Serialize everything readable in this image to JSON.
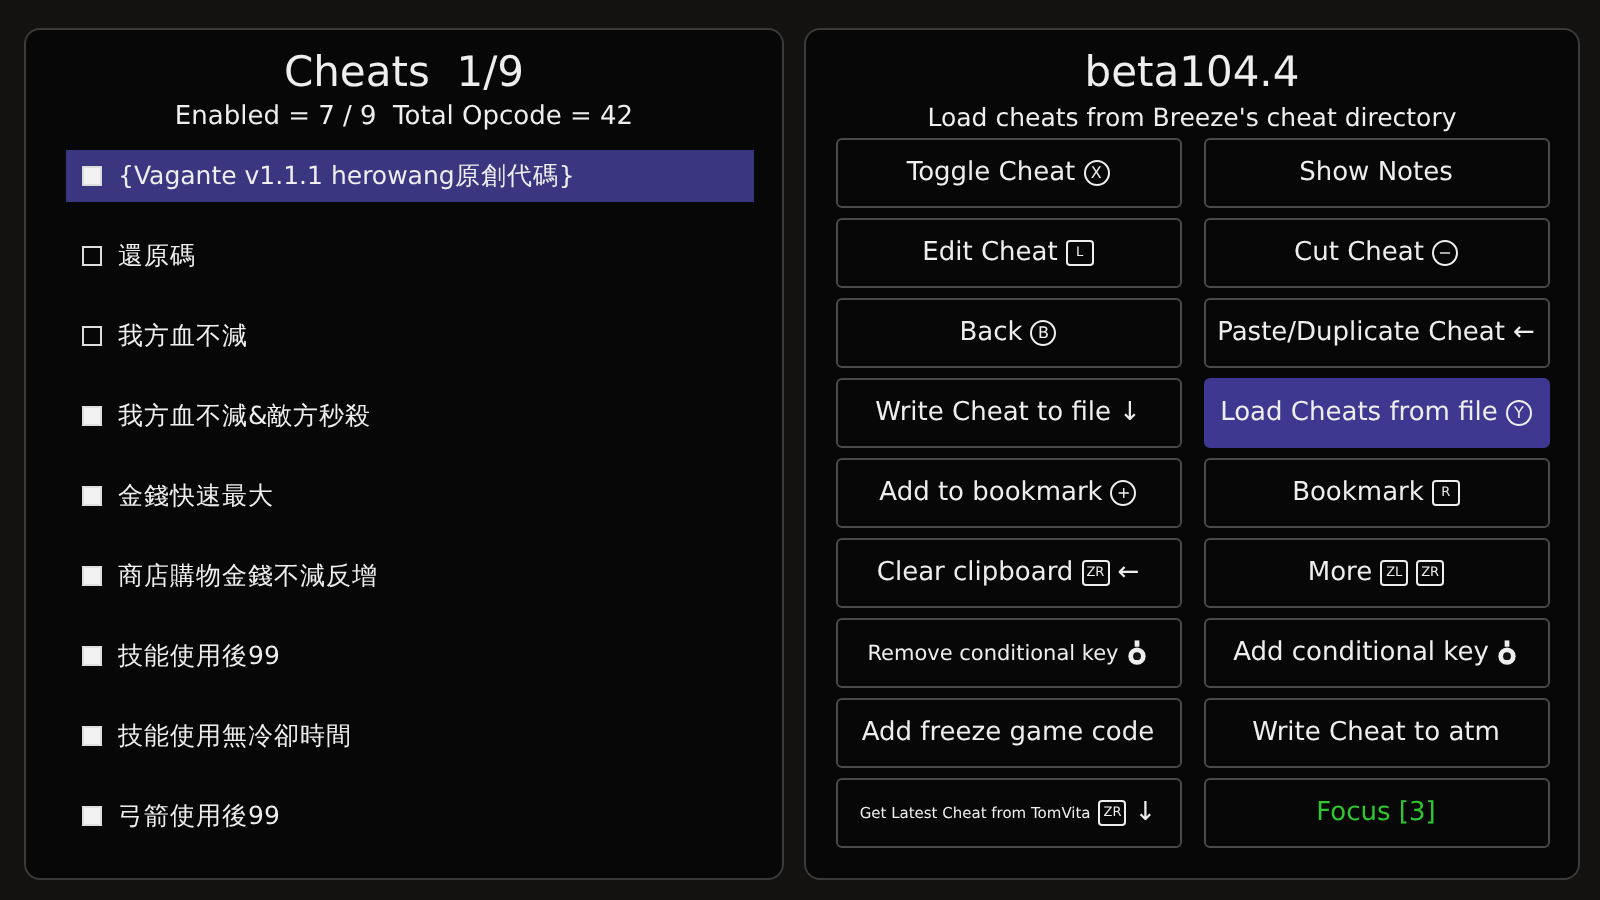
{
  "cheats_panel": {
    "title": "Cheats  1/9",
    "summary": "Enabled = 7 / 9  Total Opcode = 42",
    "items": [
      {
        "label": "{Vagante v1.1.1 herowang原創代碼}",
        "checked": true,
        "selected": true
      },
      {
        "label": "還原碼",
        "checked": false,
        "selected": false
      },
      {
        "label": "我方血不減",
        "checked": false,
        "selected": false
      },
      {
        "label": "我方血不減&敵方秒殺",
        "checked": true,
        "selected": false
      },
      {
        "label": "金錢快速最大",
        "checked": true,
        "selected": false
      },
      {
        "label": "商店購物金錢不減反增",
        "checked": true,
        "selected": false
      },
      {
        "label": "技能使用後99",
        "checked": true,
        "selected": false
      },
      {
        "label": "技能使用無冷卻時間",
        "checked": true,
        "selected": false
      },
      {
        "label": "弓箭使用後99",
        "checked": true,
        "selected": false
      }
    ]
  },
  "menu_panel": {
    "title": "beta104.4",
    "subtitle": "Load cheats from Breeze's cheat directory",
    "buttons": [
      {
        "label": "Toggle Cheat",
        "kind": "regular",
        "keys": [
          {
            "kind": "circle",
            "text": "X"
          }
        ],
        "selected": false
      },
      {
        "label": "Show Notes",
        "kind": "regular",
        "selected": false
      },
      {
        "label": "Edit Cheat",
        "kind": "regular",
        "keys": [
          {
            "kind": "box",
            "text": "L"
          }
        ],
        "selected": false
      },
      {
        "label": "Cut Cheat",
        "kind": "regular",
        "keys": [
          {
            "kind": "circle",
            "text": "−"
          }
        ],
        "selected": false
      },
      {
        "label": "Back",
        "kind": "regular",
        "keys": [
          {
            "kind": "circle",
            "text": "B"
          }
        ],
        "selected": false
      },
      {
        "label": "Paste/Duplicate Cheat",
        "kind": "regular",
        "keys": [
          {
            "kind": "arrow",
            "text": "←"
          }
        ],
        "selected": false
      },
      {
        "label": "Write Cheat to file",
        "kind": "regular",
        "keys": [
          {
            "kind": "arrow",
            "text": "↓"
          }
        ],
        "selected": false
      },
      {
        "label": "Load Cheats from file",
        "kind": "regular",
        "keys": [
          {
            "kind": "circle",
            "text": "Y"
          }
        ],
        "selected": true
      },
      {
        "label": "Add to bookmark",
        "kind": "regular",
        "keys": [
          {
            "kind": "circle",
            "text": "+"
          }
        ],
        "selected": false
      },
      {
        "label": "Bookmark",
        "kind": "regular",
        "keys": [
          {
            "kind": "box",
            "text": "R"
          }
        ],
        "selected": false
      },
      {
        "label": "Clear clipboard",
        "kind": "regular",
        "keys": [
          {
            "kind": "box",
            "text": "ZR"
          },
          {
            "kind": "arrow",
            "text": "←"
          }
        ],
        "selected": false
      },
      {
        "label": "More",
        "kind": "regular",
        "keys": [
          {
            "kind": "box",
            "text": "ZL"
          },
          {
            "kind": "box",
            "text": "ZR"
          }
        ],
        "selected": false
      },
      {
        "label": "Remove conditional key",
        "kind": "small",
        "keys": [
          {
            "kind": "stick"
          }
        ],
        "selected": false
      },
      {
        "label": "Add conditional key",
        "kind": "regular",
        "keys": [
          {
            "kind": "stick"
          }
        ],
        "selected": false
      },
      {
        "label": "Add freeze game code",
        "kind": "regular",
        "selected": false
      },
      {
        "label": "Write Cheat to atm",
        "kind": "regular",
        "selected": false
      },
      {
        "label": "Get Latest Cheat from TomVita",
        "kind": "tiny",
        "keys": [
          {
            "kind": "box",
            "text": "ZR"
          },
          {
            "kind": "arrow",
            "text": "↓"
          }
        ],
        "selected": false
      },
      {
        "label": "Focus [3]",
        "kind": "regular",
        "color": "#2fc62f",
        "selected": false
      }
    ]
  }
}
